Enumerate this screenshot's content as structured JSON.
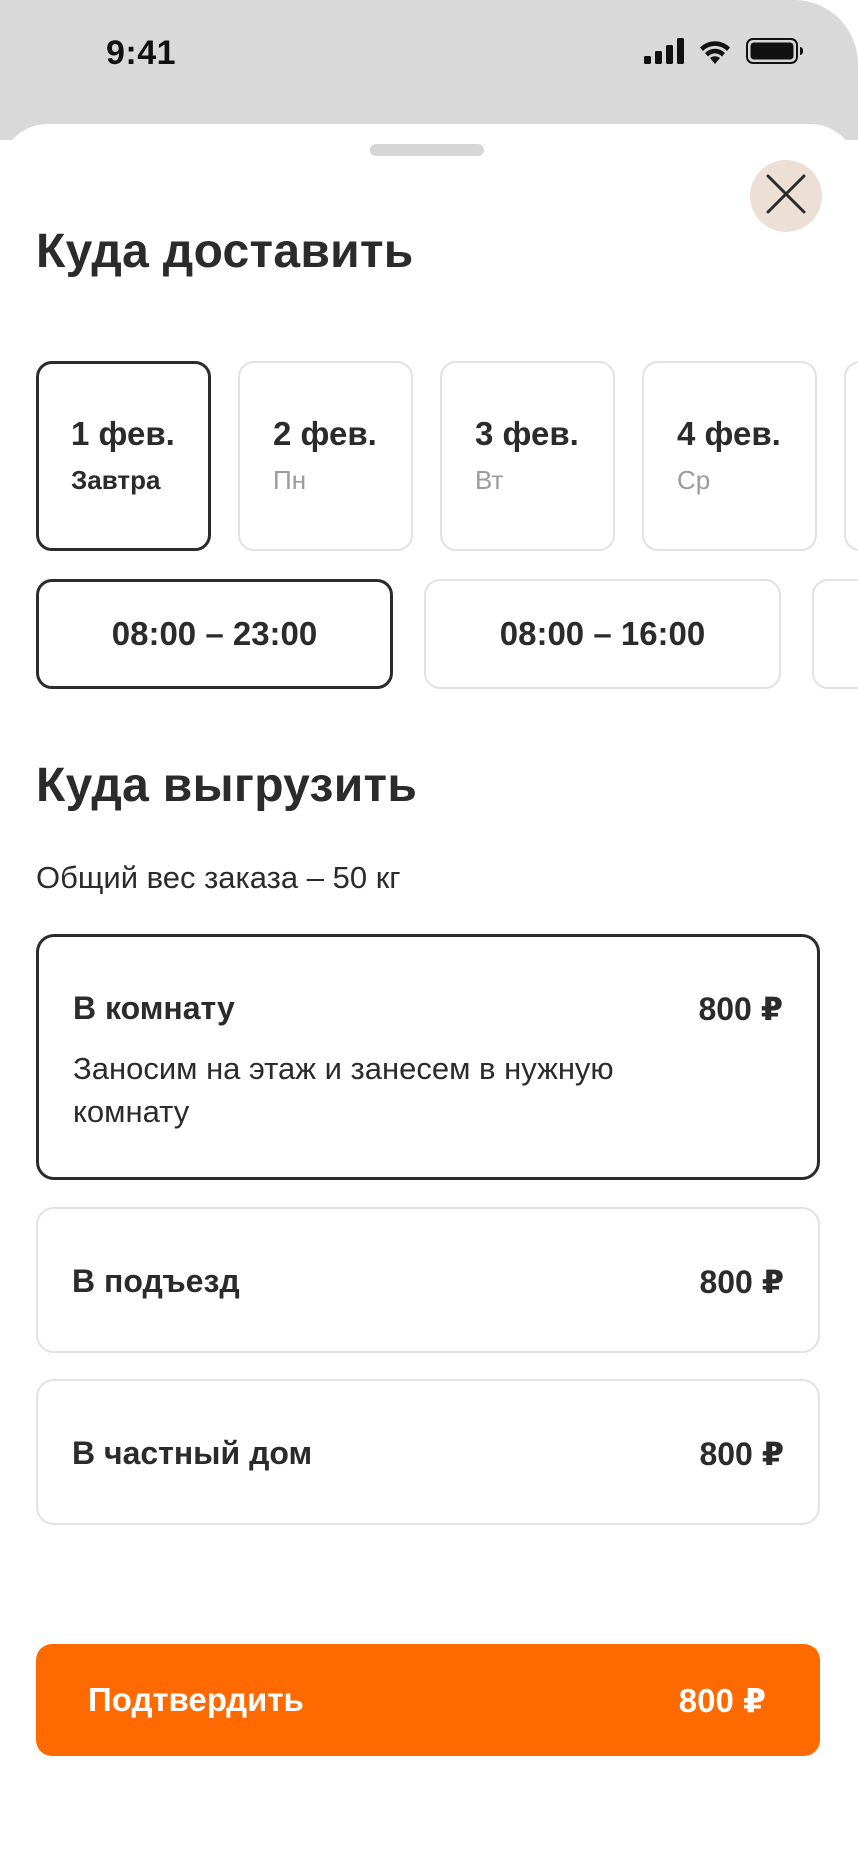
{
  "status_bar": {
    "time": "9:41"
  },
  "sheet": {
    "delivery": {
      "title": "Куда доставить",
      "dates": [
        {
          "day": "1 фев.",
          "sub": "Завтра",
          "selected": true
        },
        {
          "day": "2 фев.",
          "sub": "Пн",
          "selected": false
        },
        {
          "day": "3 фев.",
          "sub": "Вт",
          "selected": false
        },
        {
          "day": "4 фев.",
          "sub": "Ср",
          "selected": false
        }
      ],
      "slots": [
        {
          "label": "08:00 – 23:00",
          "selected": true
        },
        {
          "label": "08:00 – 16:00",
          "selected": false
        }
      ]
    },
    "unload": {
      "title": "Куда выгрузить",
      "subtitle": "Общий вес заказа – 50 кг",
      "options": [
        {
          "title": "В комнату",
          "price": "800 ₽",
          "desc": "Заносим на этаж и занесем в нужную комнату",
          "selected": true
        },
        {
          "title": "В подъезд",
          "price": "800 ₽",
          "selected": false
        },
        {
          "title": "В частный дом",
          "price": "800 ₽",
          "selected": false
        }
      ]
    },
    "confirm": {
      "label": "Подтвердить",
      "price": "800 ₽"
    }
  },
  "colors": {
    "accent": "#ff6a00",
    "text": "#2b2b2b",
    "muted": "#9b9b9b",
    "close_bg": "#ecdfd6",
    "status_bg": "#d9d9d9"
  },
  "icons": {
    "close": "close-icon",
    "signal": "cellular-signal-icon",
    "wifi": "wifi-icon",
    "battery": "battery-icon"
  }
}
